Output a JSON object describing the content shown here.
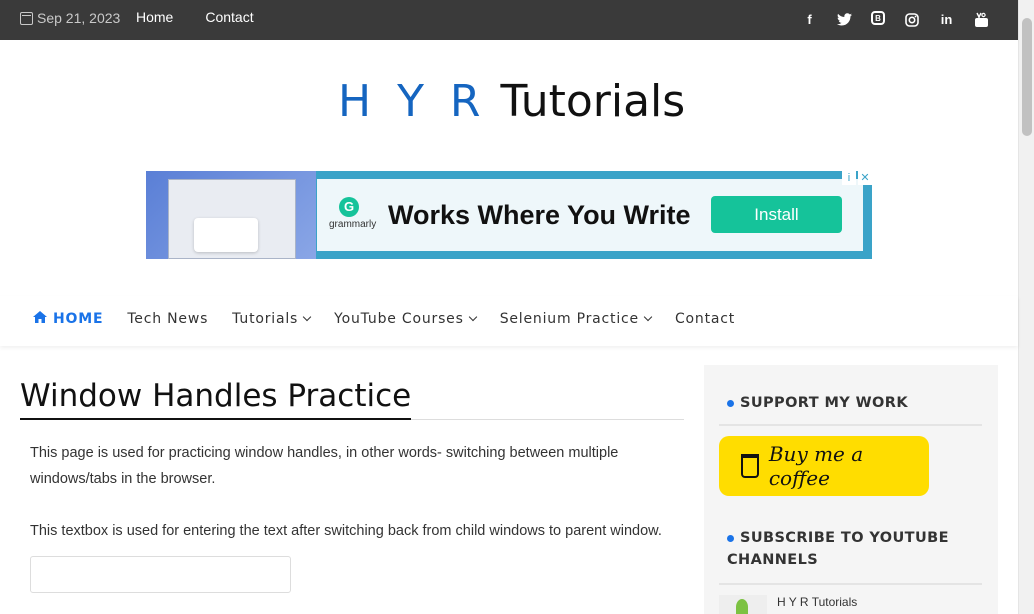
{
  "topbar": {
    "date": "Sep 21, 2023",
    "links": [
      "Home",
      "Contact"
    ],
    "social": [
      "facebook-icon",
      "twitter-icon",
      "blogger-icon",
      "instagram-icon",
      "linkedin-icon",
      "youtube-icon"
    ]
  },
  "logo": {
    "part1": "H Y R",
    "part2": "Tutorials"
  },
  "ad": {
    "brand": "grammarly",
    "headline": "Works Where You Write",
    "cta": "Install",
    "brand_color": "#15c39a"
  },
  "nav": {
    "home": "HOME",
    "items": [
      "Tech News",
      "Tutorials",
      "YouTube Courses",
      "Selenium Practice",
      "Contact"
    ],
    "accent": "#1a73e8"
  },
  "content": {
    "title": "Window Handles Practice",
    "para1": "This page is used for practicing window handles, in other words- switching between multiple windows/tabs in the browser.",
    "para2": "This textbox is used for entering the text after switching back from child windows to parent window.",
    "textbox_value": ""
  },
  "sidebar": {
    "support_title": "SUPPORT MY WORK",
    "coffee": "Buy me a coffee",
    "subscribe_title": "SUBSCRIBE TO YOUTUBE CHANNELS",
    "channel": "H Y R Tutorials"
  }
}
